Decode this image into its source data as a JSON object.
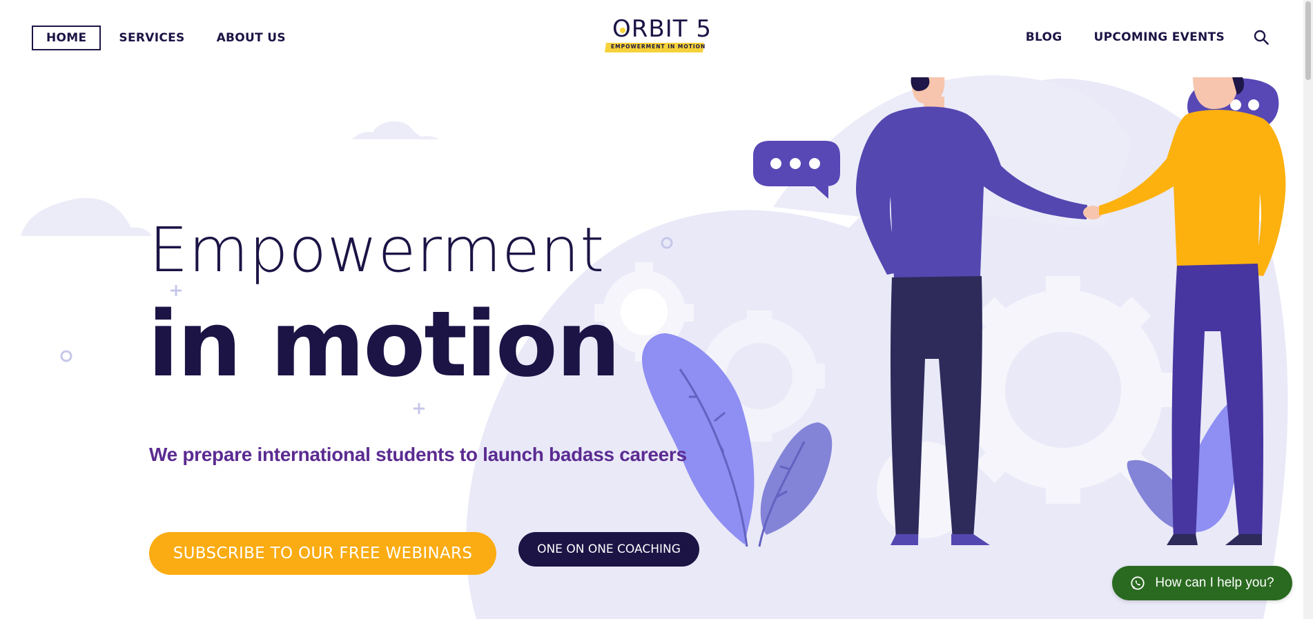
{
  "nav": {
    "left": [
      {
        "label": "HOME",
        "active": true
      },
      {
        "label": "SERVICES",
        "active": false
      },
      {
        "label": "ABOUT US",
        "active": false
      }
    ],
    "right": [
      {
        "label": "BLOG"
      },
      {
        "label": "UPCOMING EVENTS"
      }
    ],
    "search_icon": "search-icon"
  },
  "logo": {
    "wordmark": "ORBIT 5",
    "tagline": "EMPOWERMENT IN MOTION"
  },
  "hero": {
    "headline_light": "Empowerment",
    "headline_bold": "in motion",
    "tagline": "We prepare international students to launch badass careers",
    "primary_button": "SUBSCRIBE TO OUR FREE WEBINARS",
    "secondary_button": "ONE ON ONE COACHING"
  },
  "chat_widget": {
    "label": "How can I help you?",
    "icon": "whatsapp-icon"
  },
  "colors": {
    "navy": "#1b1445",
    "purple_text": "#5b2b91",
    "orange": "#fbac12",
    "whatsapp_green": "#2a6a20",
    "lavender_blob": "#e8e8f8"
  }
}
